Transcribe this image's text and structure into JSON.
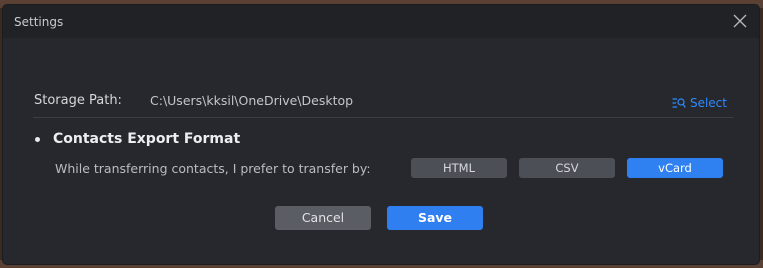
{
  "window": {
    "title": "Settings"
  },
  "storage": {
    "label": "Storage Path:",
    "path": "C:\\Users\\kksil\\OneDrive\\Desktop",
    "select_label": "Select"
  },
  "contacts_export": {
    "heading": "Contacts Export Format",
    "prompt": "While transferring contacts, I prefer to transfer by:",
    "options": [
      "HTML",
      "CSV",
      "vCard"
    ],
    "selected": "vCard"
  },
  "actions": {
    "cancel_label": "Cancel",
    "save_label": "Save"
  },
  "colors": {
    "accent": "#2f80f0",
    "dialog_bg": "#26282d",
    "button_gray": "#4c4f55"
  },
  "icons": {
    "close": "close-icon",
    "select": "list-search-icon"
  }
}
